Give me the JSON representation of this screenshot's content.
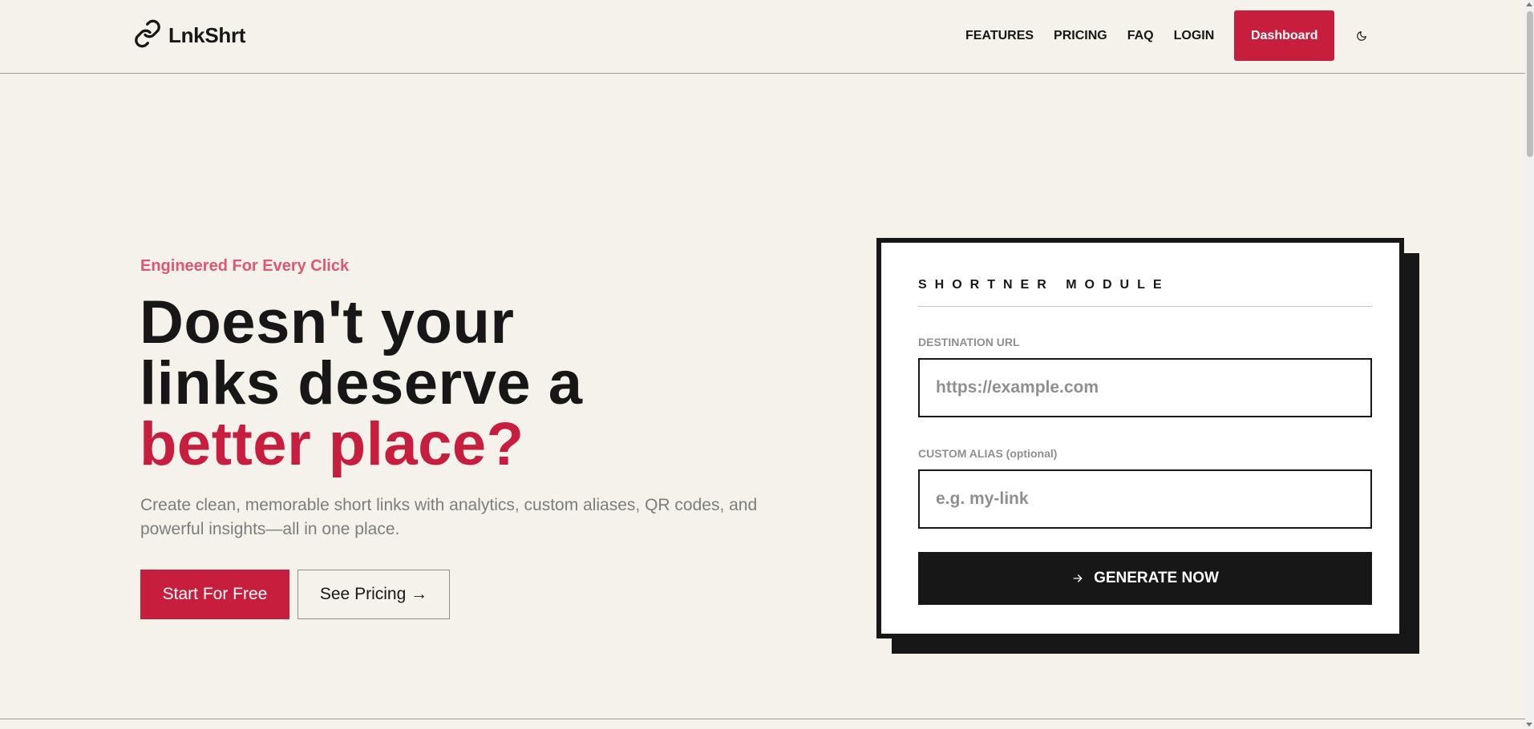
{
  "header": {
    "brand": "LnkShrt",
    "logo_icon": "link-icon",
    "nav": [
      {
        "label": "FEATURES"
      },
      {
        "label": "PRICING"
      },
      {
        "label": "FAQ"
      },
      {
        "label": "LOGIN"
      }
    ],
    "dashboard_label": "Dashboard",
    "theme_icon": "moon-icon"
  },
  "hero": {
    "eyebrow": "Engineered For Every Click",
    "headline_line1": "Doesn't your",
    "headline_line2": "links deserve a",
    "headline_accent": "better place?",
    "subtext": "Create clean, memorable short links with analytics, custom aliases, QR codes, and powerful insights—all in one place.",
    "cta_primary": "Start For Free",
    "cta_secondary": "See Pricing →"
  },
  "shortener": {
    "title": "SHORTNER MODULE",
    "destination_label": "DESTINATION URL",
    "destination_placeholder": "https://example.com",
    "destination_value": "",
    "alias_label": "CUSTOM ALIAS (optional)",
    "alias_placeholder": "e.g. my-link",
    "alias_value": "",
    "generate_label": "GENERATE NOW",
    "generate_icon": "arrow-right-icon"
  },
  "colors": {
    "background": "#f5f2ec",
    "accent": "#c81e3e",
    "eyebrow": "#e0566f",
    "ink": "#171717",
    "muted": "#7d7d7d"
  }
}
